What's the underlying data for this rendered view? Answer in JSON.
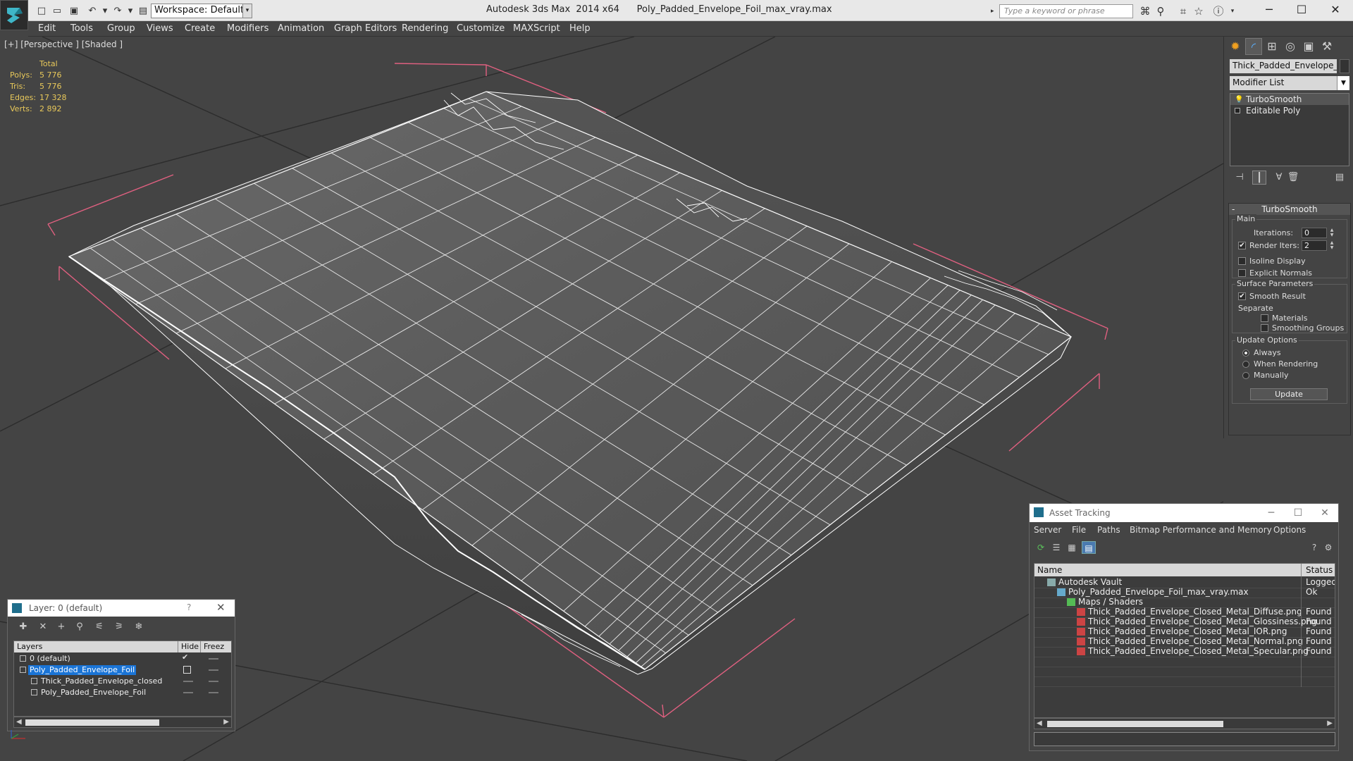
{
  "app": {
    "title": "Autodesk 3ds Max  2014 x64      Poly_Padded_Envelope_Foil_max_vray.max",
    "workspace": "Workspace: Default",
    "search_placeholder": "Type a keyword or phrase"
  },
  "menu": [
    "Edit",
    "Tools",
    "Group",
    "Views",
    "Create",
    "Modifiers",
    "Animation",
    "Graph Editors",
    "Rendering",
    "Customize",
    "MAXScript",
    "Help"
  ],
  "viewport": {
    "label": "[+] [Perspective ] [Shaded ]",
    "stats": {
      "header": "Total",
      "rows": [
        {
          "key": "Polys:",
          "value": "5 776"
        },
        {
          "key": "Tris:",
          "value": "5 776"
        },
        {
          "key": "Edges:",
          "value": "17 328"
        },
        {
          "key": "Verts:",
          "value": "2 892"
        }
      ]
    },
    "colors": {
      "background": "#444444",
      "wire": "#ffffff",
      "bbox": "#e06080",
      "grid": "#2e2e2e"
    }
  },
  "command_panel": {
    "object_name": "Thick_Padded_Envelope_clos",
    "modifier_list": "Modifier List",
    "stack": [
      "TurboSmooth",
      "Editable Poly"
    ],
    "rollout": {
      "title": "TurboSmooth",
      "main": {
        "title": "Main",
        "iterations_label": "Iterations:",
        "iterations_value": "0",
        "render_iters_label": "Render Iters:",
        "render_iters_value": "2",
        "render_iters_checked": "✔",
        "isoline_label": "Isoline Display",
        "explicit_label": "Explicit Normals"
      },
      "surface": {
        "title": "Surface Parameters",
        "smooth_label": "Smooth Result",
        "smooth_checked": "✔",
        "separate_label": "Separate",
        "materials_label": "Materials",
        "smoothing_groups_label": "Smoothing Groups"
      },
      "update": {
        "title": "Update Options",
        "always": "Always",
        "when_rendering": "When Rendering",
        "manually": "Manually",
        "button": "Update"
      }
    }
  },
  "asset_tracking": {
    "title": "Asset Tracking",
    "menu": [
      "Server",
      "File",
      "Paths",
      "Bitmap Performance and Memory",
      "Options"
    ],
    "columns": {
      "name": "Name",
      "status": "Status"
    },
    "rows": [
      {
        "name": "Autodesk Vault",
        "status": "Logged O",
        "indent": 0,
        "icon": "vault-icon"
      },
      {
        "name": "Poly_Padded_Envelope_Foil_max_vray.max",
        "status": "Ok",
        "indent": 1,
        "icon": "max-file-icon"
      },
      {
        "name": "Maps / Shaders",
        "status": "",
        "indent": 2,
        "icon": "maps-icon"
      },
      {
        "name": "Thick_Padded_Envelope_Closed_Metal_Diffuse.png",
        "status": "Found",
        "indent": 3,
        "icon": "png-icon"
      },
      {
        "name": "Thick_Padded_Envelope_Closed_Metal_Glossiness.png",
        "status": "Found",
        "indent": 3,
        "icon": "png-icon"
      },
      {
        "name": "Thick_Padded_Envelope_Closed_Metal_IOR.png",
        "status": "Found",
        "indent": 3,
        "icon": "png-icon"
      },
      {
        "name": "Thick_Padded_Envelope_Closed_Metal_Normal.png",
        "status": "Found",
        "indent": 3,
        "icon": "png-icon"
      },
      {
        "name": "Thick_Padded_Envelope_Closed_Metal_Specular.png",
        "status": "Found",
        "indent": 3,
        "icon": "png-icon"
      }
    ]
  },
  "layer_window": {
    "title": "Layer: 0 (default)",
    "help": "?",
    "columns": {
      "layers": "Layers",
      "hide": "Hide",
      "freeze": "Freez"
    },
    "rows": [
      {
        "name": "0 (default)",
        "indent": 0,
        "selected": false,
        "current": true
      },
      {
        "name": "Poly_Padded_Envelope_Foil",
        "indent": 0,
        "selected": true,
        "current": false
      },
      {
        "name": "Thick_Padded_Envelope_closed",
        "indent": 1,
        "selected": false,
        "current": false
      },
      {
        "name": "Poly_Padded_Envelope_Foil",
        "indent": 1,
        "selected": false,
        "current": false
      }
    ]
  }
}
